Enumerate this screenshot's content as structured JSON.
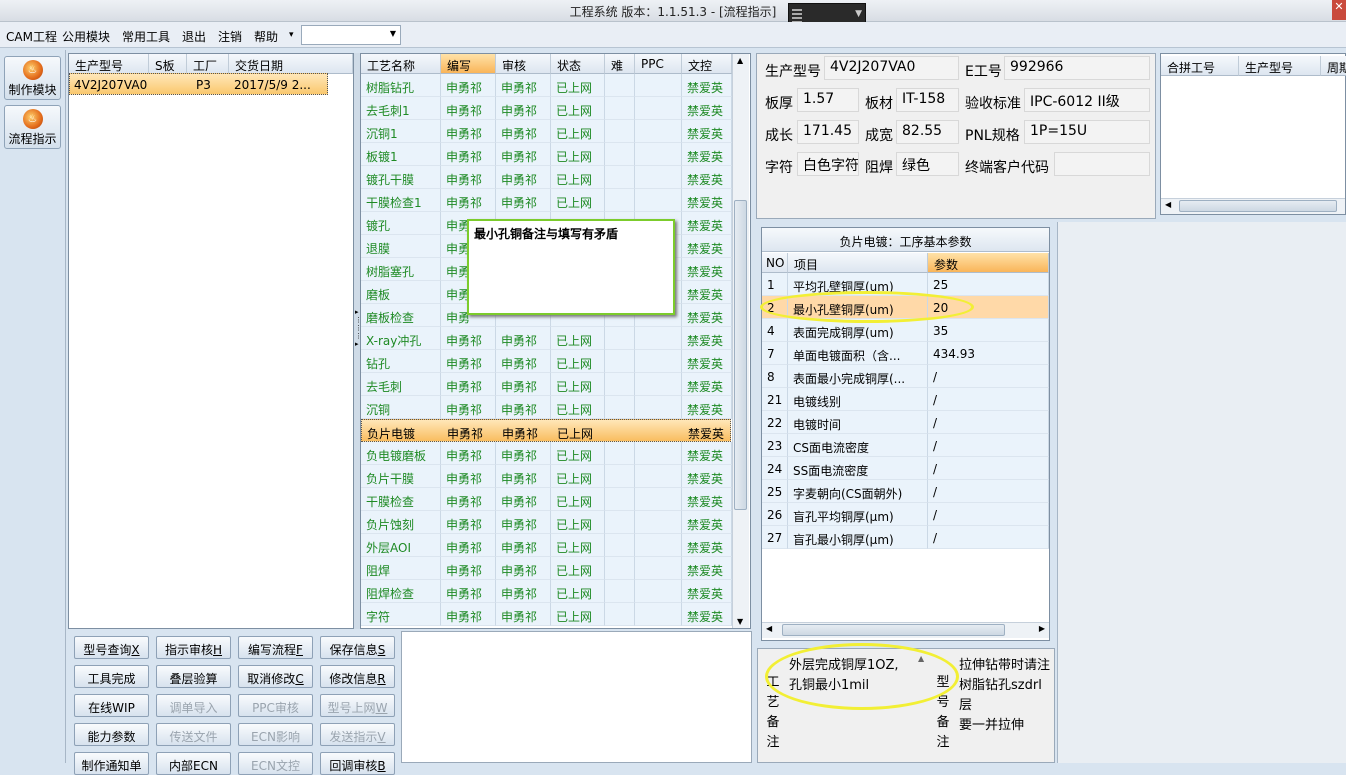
{
  "window": {
    "title": "工程系统    版本：1.1.51.3 - [流程指示]",
    "close": "✕"
  },
  "menu": {
    "items": [
      "CAM工程",
      "公用模块",
      "常用工具",
      "退出",
      "注销",
      "帮助",
      "▾"
    ]
  },
  "nav": {
    "buttons": [
      {
        "label": "制作模块",
        "icon": "flame-icon"
      },
      {
        "label": "流程指示",
        "icon": "flame-icon"
      }
    ]
  },
  "product_list": {
    "headers": [
      "生产型号",
      "S板",
      "工厂",
      "交货日期"
    ],
    "rows": [
      {
        "model": "4V2J207VA0",
        "s": "",
        "factory": "P3",
        "date": "2017/5/9 2..."
      }
    ]
  },
  "process": {
    "headers": [
      "工艺名称",
      "编写",
      "审核",
      "状态",
      "难",
      "PPC",
      "文控"
    ],
    "rows": [
      [
        "树脂钻孔",
        "申勇祁",
        "申勇祁",
        "已上网",
        "",
        "",
        "禁爱英"
      ],
      [
        "去毛刺1",
        "申勇祁",
        "申勇祁",
        "已上网",
        "",
        "",
        "禁爱英"
      ],
      [
        "沉铜1",
        "申勇祁",
        "申勇祁",
        "已上网",
        "",
        "",
        "禁爱英"
      ],
      [
        "板镀1",
        "申勇祁",
        "申勇祁",
        "已上网",
        "",
        "",
        "禁爱英"
      ],
      [
        "镀孔干膜",
        "申勇祁",
        "申勇祁",
        "已上网",
        "",
        "",
        "禁爱英"
      ],
      [
        "干膜检查1",
        "申勇祁",
        "申勇祁",
        "已上网",
        "",
        "",
        "禁爱英"
      ],
      [
        "镀孔",
        "申勇",
        "",
        "",
        "",
        "",
        "禁爱英"
      ],
      [
        "退膜",
        "申勇",
        "",
        "",
        "",
        "",
        "禁爱英"
      ],
      [
        "树脂塞孔",
        "申勇",
        "",
        "",
        "",
        "",
        "禁爱英"
      ],
      [
        "磨板",
        "申勇",
        "",
        "",
        "",
        "",
        "禁爱英"
      ],
      [
        "磨板检查",
        "申勇",
        "",
        "",
        "",
        "",
        "禁爱英"
      ],
      [
        "X-ray冲孔",
        "申勇祁",
        "申勇祁",
        "已上网",
        "",
        "",
        "禁爱英"
      ],
      [
        "钻孔",
        "申勇祁",
        "申勇祁",
        "已上网",
        "",
        "",
        "禁爱英"
      ],
      [
        "去毛刺",
        "申勇祁",
        "申勇祁",
        "已上网",
        "",
        "",
        "禁爱英"
      ],
      [
        "沉铜",
        "申勇祁",
        "申勇祁",
        "已上网",
        "",
        "",
        "禁爱英"
      ],
      [
        "负片电镀",
        "申勇祁",
        "申勇祁",
        "已上网",
        "",
        "",
        "禁爱英"
      ],
      [
        "负电镀磨板",
        "申勇祁",
        "申勇祁",
        "已上网",
        "",
        "",
        "禁爱英"
      ],
      [
        "负片干膜",
        "申勇祁",
        "申勇祁",
        "已上网",
        "",
        "",
        "禁爱英"
      ],
      [
        "干膜检查",
        "申勇祁",
        "申勇祁",
        "已上网",
        "",
        "",
        "禁爱英"
      ],
      [
        "负片蚀刻",
        "申勇祁",
        "申勇祁",
        "已上网",
        "",
        "",
        "禁爱英"
      ],
      [
        "外层AOI",
        "申勇祁",
        "申勇祁",
        "已上网",
        "",
        "",
        "禁爱英"
      ],
      [
        "阻焊",
        "申勇祁",
        "申勇祁",
        "已上网",
        "",
        "",
        "禁爱英"
      ],
      [
        "阻焊检查",
        "申勇祁",
        "申勇祁",
        "已上网",
        "",
        "",
        "禁爱英"
      ],
      [
        "字符",
        "申勇祁",
        "申勇祁",
        "已上网",
        "",
        "",
        "禁爱英"
      ]
    ],
    "selected_index": 15
  },
  "tooltip": {
    "text": "最小孔铜备注与填写有矛盾"
  },
  "info": {
    "model_label": "生产型号",
    "model": "4V2J207VA0",
    "eno_label": "E工号",
    "eno": "992966",
    "thickness_label": "板厚",
    "thickness": "1.57",
    "material_label": "板材",
    "material": "IT-158",
    "standard_label": "验收标准",
    "standard": "IPC-6012 II级",
    "length_label": "成长",
    "length": "171.45",
    "width_label": "成宽",
    "width": "82.55",
    "pnl_label": "PNL规格",
    "pnl": "1P=15U",
    "char_label": "字符",
    "char": "白色字符",
    "mask_label": "阻焊",
    "mask": "绿色",
    "customer_label": "终端客户代码",
    "customer": ""
  },
  "merge": {
    "headers": [
      "合拼工号",
      "生产型号",
      "周期"
    ]
  },
  "params": {
    "caption": "负片电镀：工序基本参数",
    "headers": [
      "NO",
      "项目",
      "参数"
    ],
    "rows": [
      [
        "1",
        "平均孔壁铜厚(um)",
        "25"
      ],
      [
        "2",
        "最小孔壁铜厚(um)",
        "20"
      ],
      [
        "4",
        "表面完成铜厚(um)",
        "35"
      ],
      [
        "7",
        "单面电镀面积（含...",
        "434.93"
      ],
      [
        "8",
        "表面最小完成铜厚(...",
        "/"
      ],
      [
        "21",
        "电镀线别",
        "/"
      ],
      [
        "22",
        "电镀时间",
        "/"
      ],
      [
        "23",
        "CS面电流密度",
        "/"
      ],
      [
        "24",
        "SS面电流密度",
        "/"
      ],
      [
        "25",
        "字麦朝向(CS面朝外)",
        "/"
      ],
      [
        "26",
        "盲孔平均铜厚(μm)",
        "/"
      ],
      [
        "27",
        "盲孔最小铜厚(μm)",
        "/"
      ]
    ],
    "selected_index": 1
  },
  "notes": {
    "process_label": [
      "工",
      "艺",
      "备",
      "注"
    ],
    "process_note": "外层完成铜厚1OZ,\n孔铜最小1mil",
    "model_label": [
      "型",
      "号",
      "备",
      "注"
    ],
    "model_note": "拉伸钻带时请注\n树脂钻孔szdrl层\n要一并拉伸"
  },
  "buttons": [
    {
      "label": "型号查询",
      "key": "X",
      "enabled": true
    },
    {
      "label": "指示审核",
      "key": "H",
      "enabled": true
    },
    {
      "label": "编写流程",
      "key": "F",
      "enabled": true
    },
    {
      "label": "保存信息",
      "key": "S",
      "enabled": true
    },
    {
      "label": "工具完成",
      "key": "",
      "enabled": true
    },
    {
      "label": "叠层验算",
      "key": "",
      "enabled": true
    },
    {
      "label": "取消修改",
      "key": "C",
      "enabled": true
    },
    {
      "label": "修改信息",
      "key": "R",
      "enabled": true
    },
    {
      "label": "在线WIP",
      "key": "",
      "enabled": true
    },
    {
      "label": "调单导入",
      "key": "",
      "enabled": false
    },
    {
      "label": "PPC审核",
      "key": "",
      "enabled": false
    },
    {
      "label": "型号上网",
      "key": "W",
      "enabled": false
    },
    {
      "label": "能力参数",
      "key": "",
      "enabled": true
    },
    {
      "label": "传送文件",
      "key": "",
      "enabled": false
    },
    {
      "label": "ECN影响",
      "key": "",
      "enabled": false
    },
    {
      "label": "发送指示",
      "key": "V",
      "enabled": false
    },
    {
      "label": "制作通知单",
      "key": "",
      "enabled": true
    },
    {
      "label": "内部ECN",
      "key": "",
      "enabled": true
    },
    {
      "label": "ECN文控",
      "key": "",
      "enabled": false
    },
    {
      "label": "回调审核",
      "key": "B",
      "enabled": true
    }
  ],
  "colors": {
    "accent": "#f9b55a",
    "status_green": "#1e8a24",
    "annotation": "#f2ef35",
    "tooltip_border": "#7ccc2c"
  }
}
